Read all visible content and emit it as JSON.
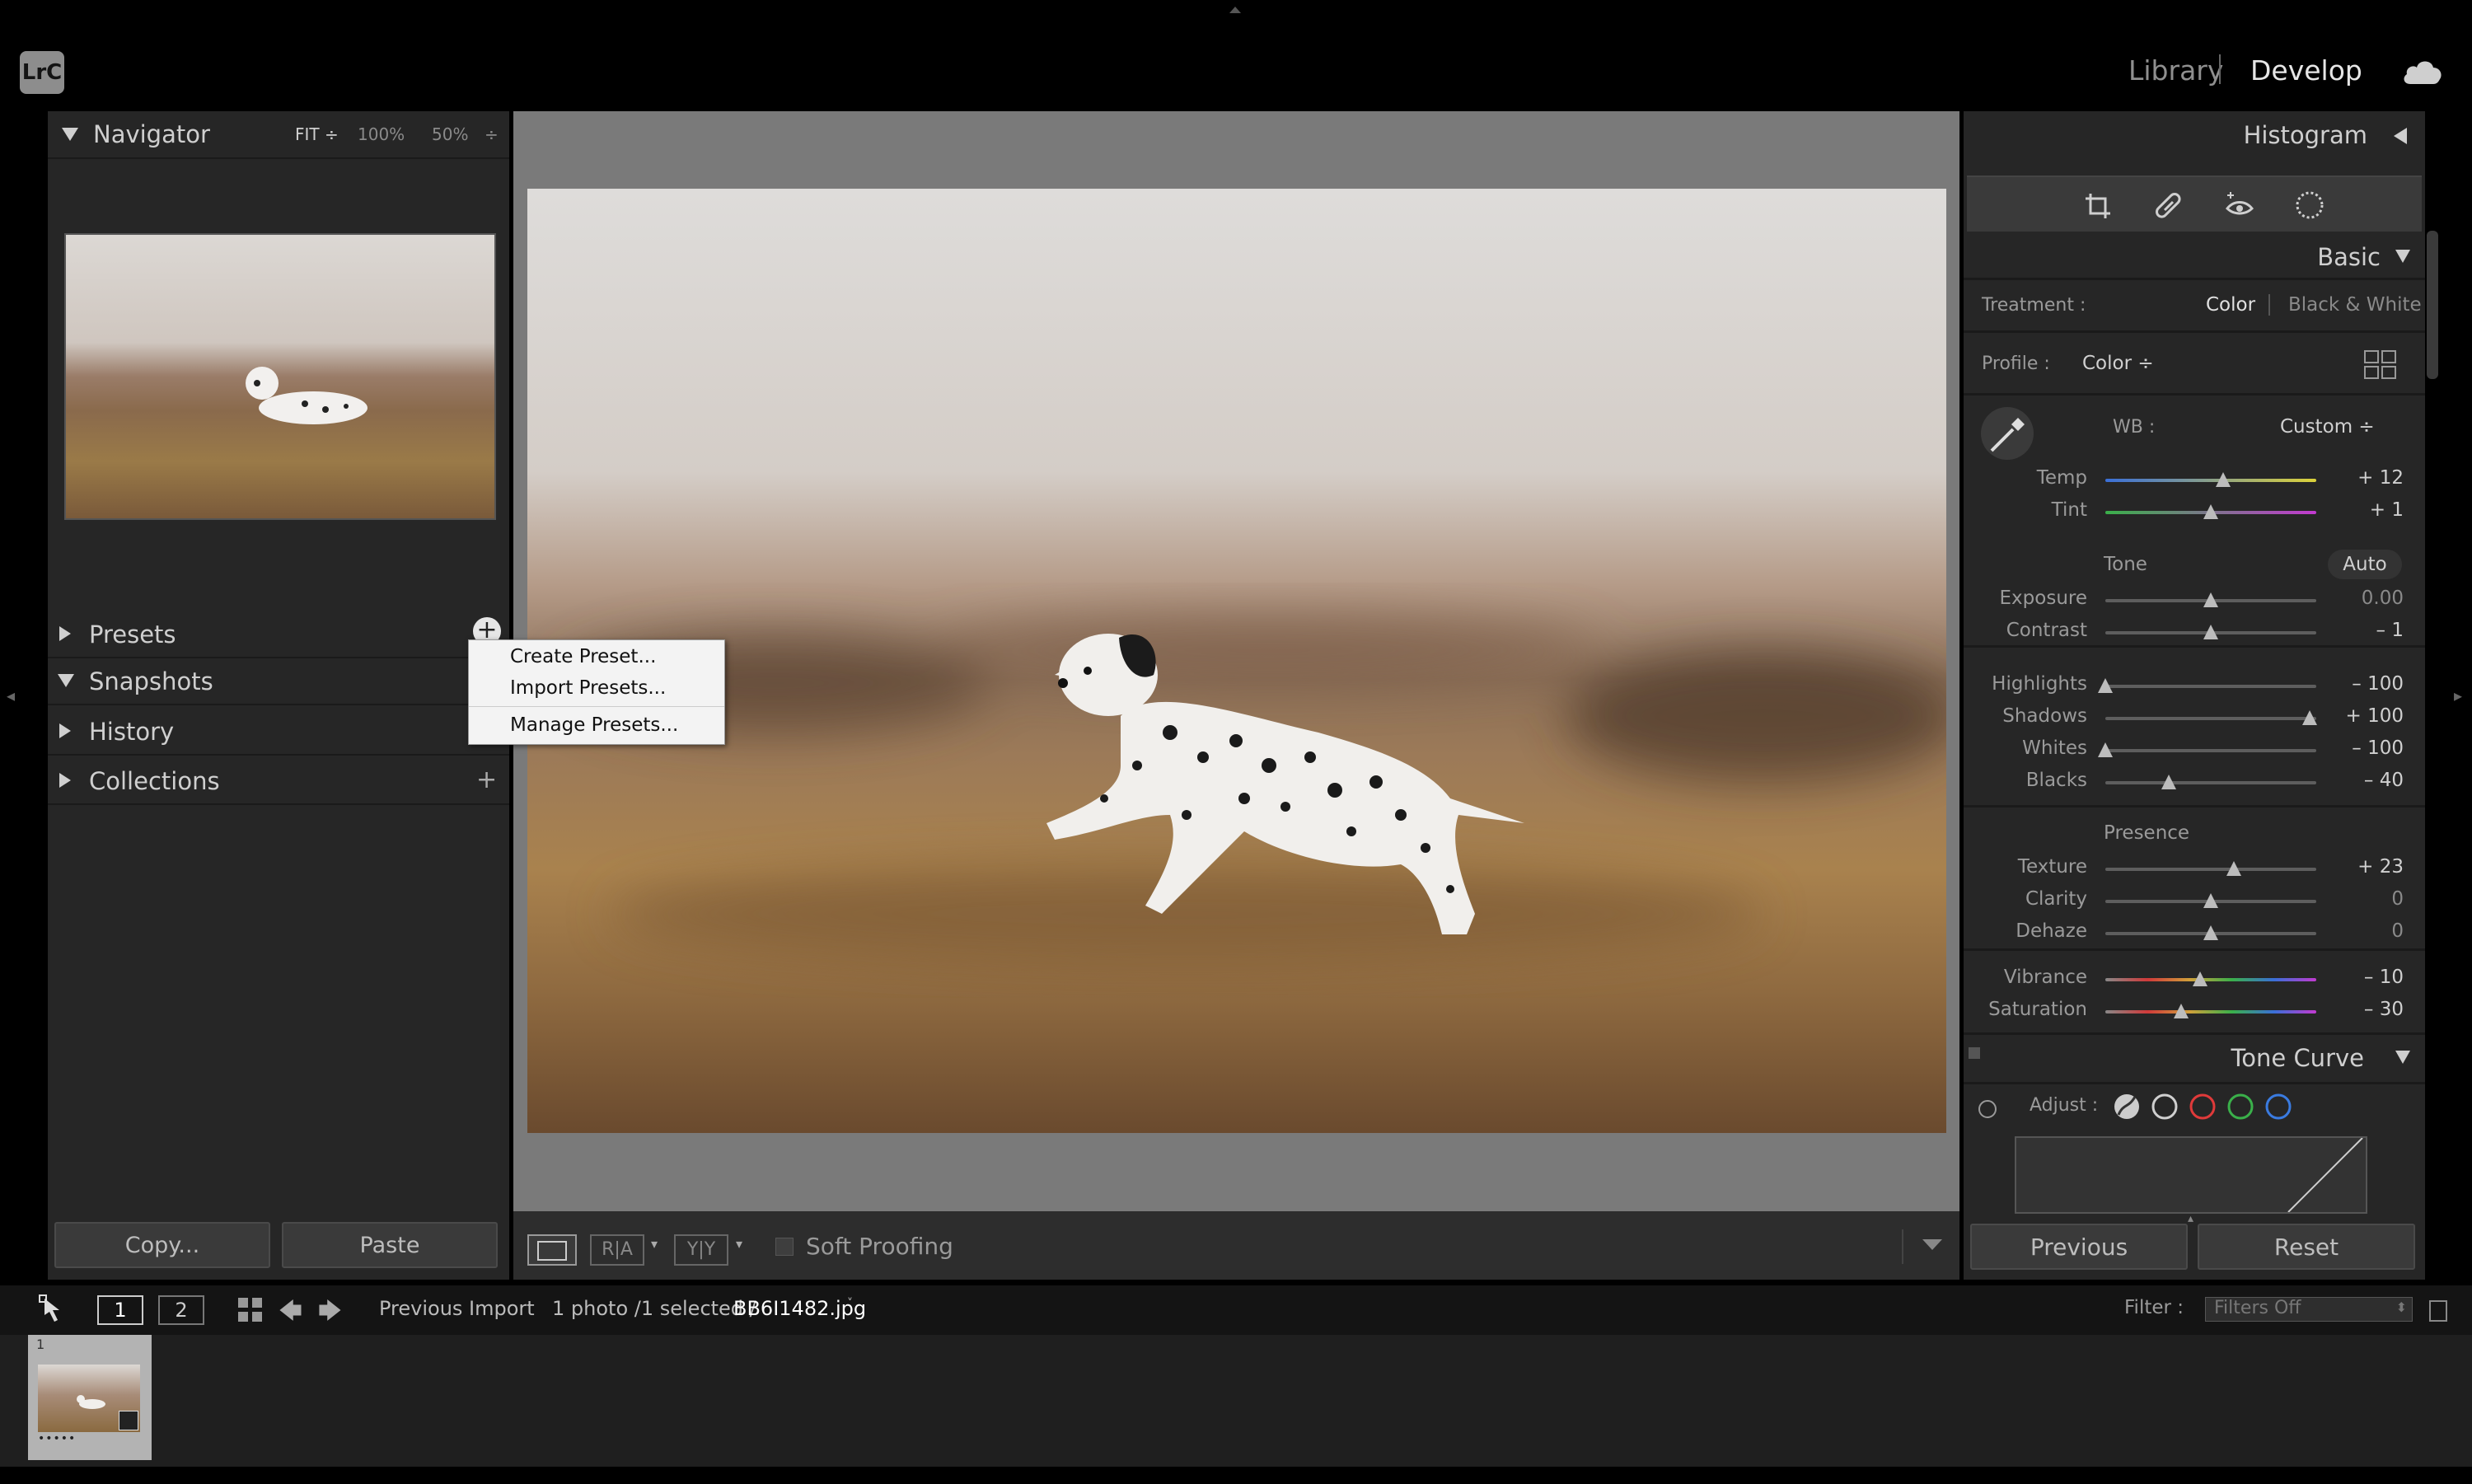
{
  "app": {
    "logo": "LrC"
  },
  "modules": {
    "library": "Library",
    "develop": "Develop"
  },
  "navigator": {
    "title": "Navigator",
    "zoom_fit": "FIT ÷",
    "zoom_100": "100%",
    "zoom_50": "50%",
    "zoom_more": "÷"
  },
  "left_panels": {
    "presets": "Presets",
    "snapshots": "Snapshots",
    "history": "History",
    "collections": "Collections"
  },
  "context_menu": {
    "create": "Create Preset...",
    "import": "Import Presets...",
    "manage": "Manage Presets..."
  },
  "left_buttons": {
    "copy": "Copy...",
    "paste": "Paste"
  },
  "toolbar": {
    "ra": "R|A",
    "yy": "Y|Y",
    "soft_proofing": "Soft Proofing"
  },
  "right": {
    "histogram": "Histogram",
    "basic": "Basic",
    "treatment_label": "Treatment :",
    "treatment_color": "Color",
    "treatment_bw": "Black & White",
    "profile_label": "Profile :",
    "profile_value": "Color ÷",
    "wb_label": "WB :",
    "wb_value": "Custom ÷",
    "tone": "Tone",
    "auto": "Auto",
    "presence": "Presence",
    "tone_curve": "Tone Curve",
    "adjust": "Adjust :",
    "previous": "Previous",
    "reset": "Reset"
  },
  "sliders": [
    {
      "label": "Temp",
      "value": "+ 12",
      "pos": 0.56,
      "kind": "temp"
    },
    {
      "label": "Tint",
      "value": "+ 1",
      "pos": 0.5,
      "kind": "tint"
    },
    {
      "label": "Exposure",
      "value": "0.00",
      "pos": 0.5,
      "kind": "gray",
      "dim": true
    },
    {
      "label": "Contrast",
      "value": "– 1",
      "pos": 0.5,
      "kind": "gray"
    },
    {
      "label": "Highlights",
      "value": "– 100",
      "pos": 0.0,
      "kind": "gray"
    },
    {
      "label": "Shadows",
      "value": "+ 100",
      "pos": 0.97,
      "kind": "gray"
    },
    {
      "label": "Whites",
      "value": "– 100",
      "pos": 0.0,
      "kind": "gray"
    },
    {
      "label": "Blacks",
      "value": "– 40",
      "pos": 0.3,
      "kind": "gray"
    },
    {
      "label": "Texture",
      "value": "+ 23",
      "pos": 0.61,
      "kind": "gray"
    },
    {
      "label": "Clarity",
      "value": "0",
      "pos": 0.5,
      "kind": "gray",
      "dim": true
    },
    {
      "label": "Dehaze",
      "value": "0",
      "pos": 0.5,
      "kind": "gray",
      "dim": true
    },
    {
      "label": "Vibrance",
      "value": "– 10",
      "pos": 0.45,
      "kind": "sat"
    },
    {
      "label": "Saturation",
      "value": "– 30",
      "pos": 0.36,
      "kind": "sat"
    }
  ],
  "filmstrip": {
    "view1": "1",
    "view2": "2",
    "source": "Previous Import",
    "count": "1 photo /1 selected /",
    "filename": "BB6I1482.jpg",
    "filename_suffix": "˅",
    "filter_label": "Filter :",
    "filter_value": "Filters Off",
    "thumb_index": "1",
    "thumb_rating": "•••••"
  }
}
